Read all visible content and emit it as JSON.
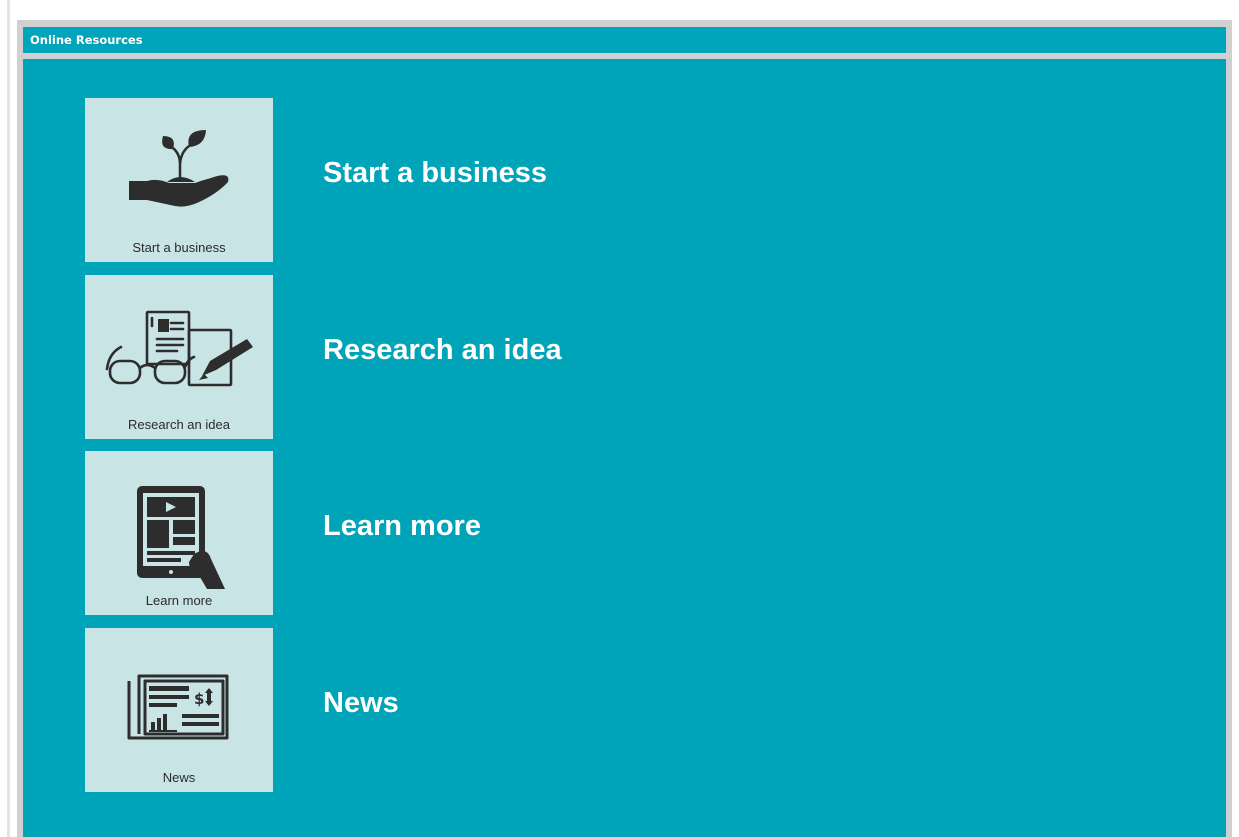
{
  "header": {
    "title": "Online Resources"
  },
  "resources": [
    {
      "tile_caption": "Start a business",
      "heading": "Start a business",
      "icon": "plant-in-hand-icon"
    },
    {
      "tile_caption": "Research an idea",
      "heading": "Research an idea",
      "icon": "glasses-document-pencil-icon"
    },
    {
      "tile_caption": "Learn more",
      "heading": "Learn more",
      "icon": "tablet-video-icon"
    },
    {
      "tile_caption": "News",
      "heading": "News",
      "icon": "newspaper-icon"
    }
  ],
  "colors": {
    "header_bg": "#00a5bb",
    "content_bg": "#00a4b8",
    "tile_bg": "#c8e4e5",
    "icon": "#2d2d2d",
    "frame": "#d0d0d0"
  }
}
